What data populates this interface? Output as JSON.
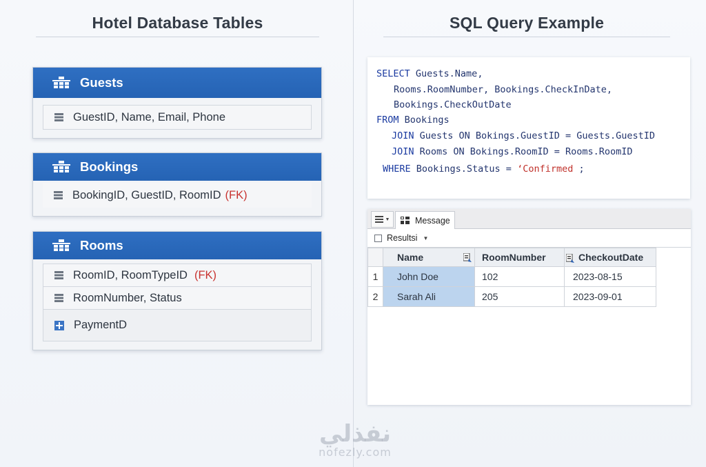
{
  "left_title": "Hotel Database Tables",
  "right_title": "SQL Query Example",
  "tables": [
    {
      "name": "Guests",
      "rows": [
        {
          "text": "GuestID, Name, Email, Phone",
          "fk": ""
        }
      ]
    },
    {
      "name": "Bookings",
      "rows": [
        {
          "text": "BookingID, GuestID, RoomID",
          "fk": "(FK)"
        }
      ]
    },
    {
      "name": "Rooms",
      "rows": [
        {
          "text": "RoomID, RoomTypeID",
          "fk": "(FK)"
        },
        {
          "text": "RoomNumber, Status",
          "fk": ""
        },
        {
          "text": "PaymentD",
          "fk": ""
        }
      ]
    }
  ],
  "sql": {
    "l1_kw": "SELECT",
    "l1_rest": " Guests.Name,",
    "l2": "Rooms.RoomNumber, Bookings.CheckInDate,",
    "l3": "Bookings.CheckOutDate",
    "l4_kw": "FROM",
    "l4_rest": " Bookings",
    "l5_kw": "JOIN",
    "l5_rest": " Guests ON Bokings.GuestID = Guests.GuestID",
    "l6_kw": "JOIN",
    "l6_rest": " Rooms ON Bokings.RoomID = Rooms.RoomID",
    "l7_kw": "WHERE",
    "l7_rest": " Bookings.Status = ",
    "l7_str": "‘Confirmed",
    "l7_end": " ;"
  },
  "results": {
    "message_tab": "Message",
    "results_label": "Resultsi",
    "columns": [
      "Name",
      "RoomNumber",
      "CheckoutDate"
    ],
    "rows": [
      {
        "idx": "1",
        "name": "John Doe",
        "room": "102",
        "date": "2023-08-15"
      },
      {
        "idx": "2",
        "name": "Sarah Ali",
        "room": "205",
        "date": "2023-09-01"
      }
    ]
  },
  "watermark": {
    "main": "نفذلي",
    "sub": "nofezly.com"
  },
  "colors": {
    "header_blue": "#2563b4",
    "fk_red": "#c8322f",
    "selection": "#bcd4ee"
  }
}
